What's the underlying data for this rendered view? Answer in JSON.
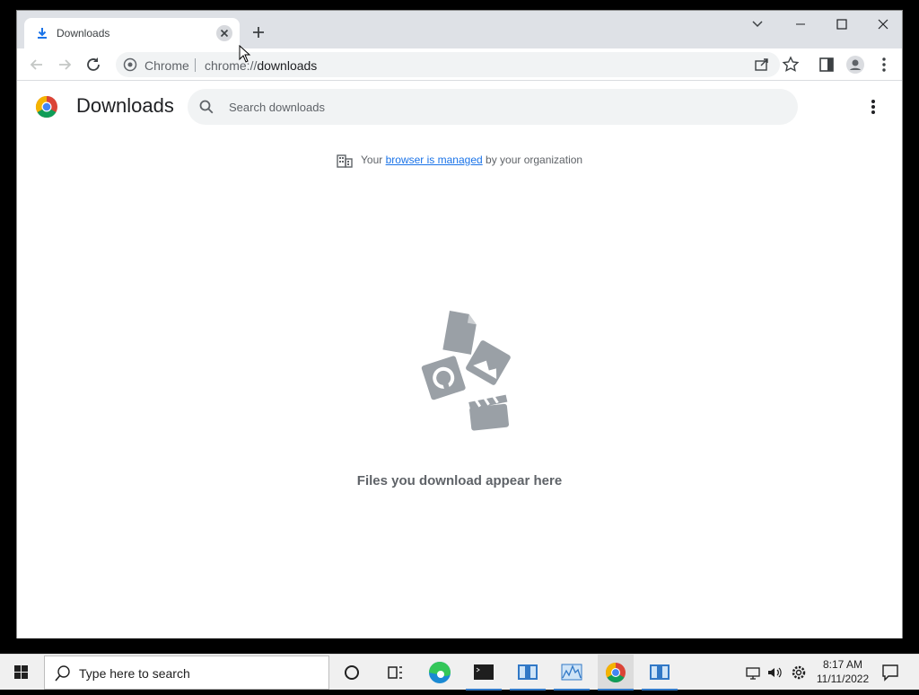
{
  "browser": {
    "tab": {
      "title": "Downloads",
      "icon": "download-icon"
    },
    "omnibox": {
      "site_name": "Chrome",
      "url_scheme": "chrome://",
      "url_path": "downloads"
    }
  },
  "page": {
    "title": "Downloads",
    "search": {
      "placeholder": "Search downloads",
      "value": ""
    },
    "managed_notice": {
      "prefix": "Your",
      "link": "browser is managed",
      "suffix": "by your organization"
    },
    "empty_message": "Files you download appear here"
  },
  "taskbar": {
    "search_text": "Type here to search",
    "time": "8:17 AM",
    "date": "11/11/2022"
  },
  "colors": {
    "accent": "#1a73e8",
    "tab_strip": "#dee1e6",
    "illustration": "#9aa0a6"
  }
}
